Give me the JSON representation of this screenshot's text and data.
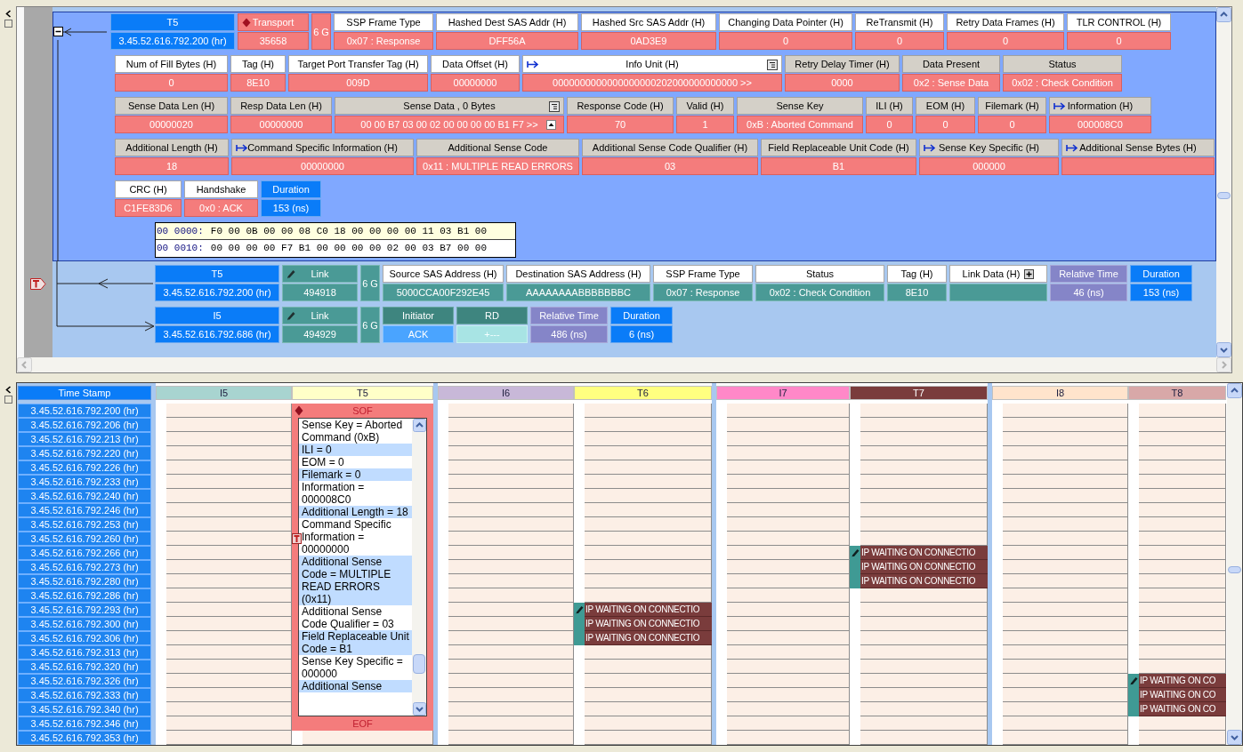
{
  "top_panel": {
    "expanded": true,
    "frame_rows": [
      [
        {
          "kind": "timestamp",
          "header": "T5",
          "value": "3.45.52.616.792.200 (hr)"
        },
        {
          "kind": "transport",
          "header": "Transport",
          "value": "35658"
        },
        {
          "kind": "speed",
          "text": "6 G"
        },
        {
          "kind": "plain",
          "header": "SSP Frame Type",
          "value": "0x07 : Response"
        },
        {
          "kind": "plain",
          "header": "Hashed Dest SAS Addr (H)",
          "value": "DFF56A"
        },
        {
          "kind": "plain",
          "header": "Hashed Src SAS Addr (H)",
          "value": "0AD3E9"
        },
        {
          "kind": "plain",
          "header": "Changing Data Pointer (H)",
          "value": "0"
        },
        {
          "kind": "plain",
          "header": "ReTransmit (H)",
          "value": "0"
        },
        {
          "kind": "plain",
          "header": "Retry Data Frames (H)",
          "value": "0"
        },
        {
          "kind": "plain",
          "header": "TLR CONTROL (H)",
          "value": "0"
        }
      ],
      [
        {
          "kind": "plain",
          "header": "Num of Fill Bytes (H)",
          "value": "0"
        },
        {
          "kind": "plain",
          "header": "Tag (H)",
          "value": "8E10"
        },
        {
          "kind": "plain",
          "header": "Target Port Transfer Tag (H)",
          "value": "009D"
        },
        {
          "kind": "plain",
          "header": "Data Offset (H)",
          "value": "00000000"
        },
        {
          "kind": "infounit",
          "header": "Info Unit (H)",
          "value": "0000000000000000000202000000000000 >>"
        },
        {
          "kind": "shaded",
          "header": "Retry Delay Timer (H)",
          "value": "0000"
        },
        {
          "kind": "shaded",
          "header": "Data Present",
          "value": "0x2 : Sense Data"
        },
        {
          "kind": "shaded",
          "header": "Status",
          "value": "0x02 : Check Condition"
        }
      ],
      [
        {
          "kind": "shaded",
          "header": "Sense Data Len (H)",
          "value": "00000020"
        },
        {
          "kind": "shaded",
          "header": "Resp Data Len (H)",
          "value": "00000000"
        },
        {
          "kind": "sensedata",
          "header": "Sense Data , 0 Bytes",
          "value": "00 00 B7 03 00 02 00 00 00 00 B1 F7  >>"
        },
        {
          "kind": "shaded",
          "header": "Response Code (H)",
          "value": "70"
        },
        {
          "kind": "shaded",
          "header": "Valid (H)",
          "value": "1"
        },
        {
          "kind": "shaded",
          "header": "Sense Key",
          "value": "0xB : Aborted Command"
        },
        {
          "kind": "shaded",
          "header": "ILI (H)",
          "value": "0"
        },
        {
          "kind": "shaded",
          "header": "EOM (H)",
          "value": "0"
        },
        {
          "kind": "shaded",
          "header": "Filemark (H)",
          "value": "0"
        },
        {
          "kind": "expandable",
          "header": "Information (H)",
          "value": "000008C0"
        }
      ],
      [
        {
          "kind": "shaded",
          "header": "Additional Length (H)",
          "value": "18"
        },
        {
          "kind": "expandable",
          "header": "Command Specific Information (H)",
          "value": "00000000"
        },
        {
          "kind": "shaded",
          "header": "Additional Sense Code",
          "value": "0x11 : MULTIPLE READ ERRORS"
        },
        {
          "kind": "shaded",
          "header": "Additional Sense Code Qualifier (H)",
          "value": "03"
        },
        {
          "kind": "shaded",
          "header": "Field Replaceable Unit Code (H)",
          "value": "B1"
        },
        {
          "kind": "expandable",
          "header": "Sense Key Specific (H)",
          "value": "000000"
        },
        {
          "kind": "expandable",
          "header": "Additional Sense Bytes (H)"
        }
      ],
      [
        {
          "kind": "plain",
          "header": "CRC (H)",
          "value": "C1FE83D6"
        },
        {
          "kind": "plain",
          "header": "Handshake",
          "value": "0x0 : ACK"
        },
        {
          "kind": "timestamp",
          "header": "Duration",
          "value": "153 (ns)"
        }
      ]
    ],
    "hex_dump": [
      {
        "offset": "00 0000:",
        "bytes": "F0 00 0B 00 00 08 C0 18 00 00 00 00 11 03 B1 00"
      },
      {
        "offset": "00 0010:",
        "bytes": "00 00 00 00 F7 B1 00 00 00 00 02 00 03 B7 00 00"
      }
    ],
    "link_rows": [
      {
        "kind": "target",
        "fields": [
          {
            "kind": "timestamp",
            "header": "T5",
            "value": "3.45.52.616.792.200 (hr)"
          },
          {
            "kind": "link",
            "header": "Link",
            "value": "494918"
          },
          {
            "kind": "speed",
            "text": "6 G"
          },
          {
            "kind": "plain",
            "header": "Source SAS Address (H)",
            "value": "5000CCA00F292E45"
          },
          {
            "kind": "plain",
            "header": "Destination SAS Address (H)",
            "value": "AAAAAAAABBBBBBBC"
          },
          {
            "kind": "plain",
            "header": "SSP Frame Type",
            "value": "0x07 : Response"
          },
          {
            "kind": "plain",
            "header": "Status",
            "value": "0x02 : Check Condition"
          },
          {
            "kind": "plain",
            "header": "Tag (H)",
            "value": "8E10"
          },
          {
            "kind": "linkdata",
            "header": "Link Data (H)"
          },
          {
            "kind": "timing",
            "header": "Relative Time",
            "value": "46 (ns)"
          },
          {
            "kind": "timestamp",
            "header": "Duration",
            "value": "153 (ns)"
          }
        ]
      },
      {
        "kind": "initiator",
        "fields": [
          {
            "kind": "timestamp",
            "header": "I5",
            "value": "3.45.52.616.792.686 (hr)"
          },
          {
            "kind": "link",
            "header": "Link",
            "value": "494929"
          },
          {
            "kind": "speed",
            "text": "6 G"
          },
          {
            "kind": "primitive",
            "header": "Initiator",
            "value": "ACK"
          },
          {
            "kind": "disparity",
            "header": "RD",
            "value": "+---"
          },
          {
            "kind": "timing",
            "header": "Relative Time",
            "value": "486 (ns)"
          },
          {
            "kind": "timestamp",
            "header": "Duration",
            "value": "6 (ns)"
          }
        ]
      }
    ]
  },
  "timeline": {
    "timestamp_header": "Time Stamp",
    "timestamps": [
      "3.45.52.616.792.200 (hr)",
      "3.45.52.616.792.206 (hr)",
      "3.45.52.616.792.213 (hr)",
      "3.45.52.616.792.220 (hr)",
      "3.45.52.616.792.226 (hr)",
      "3.45.52.616.792.233 (hr)",
      "3.45.52.616.792.240 (hr)",
      "3.45.52.616.792.246 (hr)",
      "3.45.52.616.792.253 (hr)",
      "3.45.52.616.792.260 (hr)",
      "3.45.52.616.792.266 (hr)",
      "3.45.52.616.792.273 (hr)",
      "3.45.52.616.792.280 (hr)",
      "3.45.52.616.792.286 (hr)",
      "3.45.52.616.792.293 (hr)",
      "3.45.52.616.792.300 (hr)",
      "3.45.52.616.792.306 (hr)",
      "3.45.52.616.792.313 (hr)",
      "3.45.52.616.792.320 (hr)",
      "3.45.52.616.792.326 (hr)",
      "3.45.52.616.792.333 (hr)",
      "3.45.52.616.792.340 (hr)",
      "3.45.52.616.792.346 (hr)",
      "3.45.52.616.792.353 (hr)"
    ],
    "channels": [
      {
        "label": "I5",
        "color": "#a8d4d0",
        "cells": [
          {
            "kind": "blank"
          },
          {
            "kind": "blank"
          },
          {
            "kind": "blank"
          },
          {
            "kind": "blank"
          },
          {
            "kind": "blank"
          },
          {
            "kind": "blank"
          },
          {
            "kind": "blank"
          },
          {
            "kind": "blank"
          },
          {
            "kind": "blank"
          },
          {
            "kind": "blank"
          },
          {
            "kind": "blank"
          },
          {
            "kind": "blank"
          },
          {
            "kind": "blank"
          },
          {
            "kind": "blank"
          },
          {
            "kind": "blank"
          },
          {
            "kind": "blank"
          },
          {
            "kind": "blank"
          },
          {
            "kind": "blank"
          },
          {
            "kind": "blank"
          },
          {
            "kind": "blank"
          },
          {
            "kind": "blank"
          },
          {
            "kind": "blank"
          },
          {
            "kind": "blank"
          },
          {
            "kind": "blank"
          }
        ]
      },
      {
        "label": "T5",
        "color": "#ffffc8",
        "cells": [
          {
            "kind": "popup",
            "sof": "SOF",
            "eof": "EOF",
            "lines": [
              {
                "text": "Sense Key = Aborted Command (0xB)",
                "highlighted": false
              },
              {
                "text": "ILI = 0",
                "highlighted": true
              },
              {
                "text": "EOM = 0",
                "highlighted": false
              },
              {
                "text": "Filemark = 0",
                "highlighted": true
              },
              {
                "text": "Information = 000008C0",
                "highlighted": false
              },
              {
                "text": "Additional Length = 18",
                "highlighted": true
              },
              {
                "text": "Command Specific Information = 00000000",
                "highlighted": false
              },
              {
                "text": "Additional Sense Code = MULTIPLE READ ERRORS (0x11)",
                "highlighted": true
              },
              {
                "text": "Additional Sense Code Qualifier = 03",
                "highlighted": false
              },
              {
                "text": "Field Replaceable Unit Code = B1",
                "highlighted": true
              },
              {
                "text": "Sense Key Specific = 000000",
                "highlighted": false
              },
              {
                "text": "Additional Sense",
                "highlighted": true
              }
            ]
          },
          {
            "kind": "blank"
          }
        ]
      },
      {
        "label": "I6",
        "color": "#c8b8d8",
        "cells": [
          {
            "kind": "blank"
          },
          {
            "kind": "blank"
          },
          {
            "kind": "blank"
          },
          {
            "kind": "blank"
          },
          {
            "kind": "blank"
          },
          {
            "kind": "blank"
          },
          {
            "kind": "blank"
          },
          {
            "kind": "blank"
          },
          {
            "kind": "blank"
          },
          {
            "kind": "blank"
          },
          {
            "kind": "blank"
          },
          {
            "kind": "blank"
          },
          {
            "kind": "blank"
          },
          {
            "kind": "blank"
          },
          {
            "kind": "blank"
          },
          {
            "kind": "blank"
          },
          {
            "kind": "blank"
          },
          {
            "kind": "blank"
          },
          {
            "kind": "blank"
          },
          {
            "kind": "blank"
          },
          {
            "kind": "blank"
          },
          {
            "kind": "blank"
          },
          {
            "kind": "blank"
          },
          {
            "kind": "blank"
          }
        ]
      },
      {
        "label": "T6",
        "color": "#ffff80",
        "cells": [
          {
            "kind": "blank"
          },
          {
            "kind": "blank"
          },
          {
            "kind": "blank"
          },
          {
            "kind": "blank"
          },
          {
            "kind": "blank"
          },
          {
            "kind": "blank"
          },
          {
            "kind": "blank"
          },
          {
            "kind": "blank"
          },
          {
            "kind": "blank"
          },
          {
            "kind": "blank"
          },
          {
            "kind": "blank"
          },
          {
            "kind": "blank"
          },
          {
            "kind": "blank"
          },
          {
            "kind": "blank"
          },
          {
            "kind": "event",
            "first": true,
            "text": "IP WAITING ON CONNECTIO"
          },
          {
            "kind": "event",
            "first": false,
            "text": "IP WAITING ON CONNECTIO"
          },
          {
            "kind": "event",
            "first": false,
            "text": "IP WAITING ON CONNECTIO"
          },
          {
            "kind": "blank"
          },
          {
            "kind": "blank"
          },
          {
            "kind": "blank"
          },
          {
            "kind": "blank"
          },
          {
            "kind": "blank"
          },
          {
            "kind": "blank"
          },
          {
            "kind": "blank"
          }
        ]
      },
      {
        "label": "I7",
        "color": "#ff88c8",
        "cells": [
          {
            "kind": "blank"
          },
          {
            "kind": "blank"
          },
          {
            "kind": "blank"
          },
          {
            "kind": "blank"
          },
          {
            "kind": "blank"
          },
          {
            "kind": "blank"
          },
          {
            "kind": "blank"
          },
          {
            "kind": "blank"
          },
          {
            "kind": "blank"
          },
          {
            "kind": "blank"
          },
          {
            "kind": "blank"
          },
          {
            "kind": "blank"
          },
          {
            "kind": "blank"
          },
          {
            "kind": "blank"
          },
          {
            "kind": "blank"
          },
          {
            "kind": "blank"
          },
          {
            "kind": "blank"
          },
          {
            "kind": "blank"
          },
          {
            "kind": "blank"
          },
          {
            "kind": "blank"
          },
          {
            "kind": "blank"
          },
          {
            "kind": "blank"
          },
          {
            "kind": "blank"
          },
          {
            "kind": "blank"
          }
        ]
      },
      {
        "label": "T7",
        "color": "#7a3c3c",
        "cells": [
          {
            "kind": "blank"
          },
          {
            "kind": "blank"
          },
          {
            "kind": "blank"
          },
          {
            "kind": "blank"
          },
          {
            "kind": "blank"
          },
          {
            "kind": "blank"
          },
          {
            "kind": "blank"
          },
          {
            "kind": "blank"
          },
          {
            "kind": "blank"
          },
          {
            "kind": "blank"
          },
          {
            "kind": "event",
            "first": true,
            "text": "IP WAITING ON CONNECTIO"
          },
          {
            "kind": "event",
            "first": false,
            "text": "IP WAITING ON CONNECTIO"
          },
          {
            "kind": "event",
            "first": false,
            "text": "IP WAITING ON CONNECTIO"
          },
          {
            "kind": "blank"
          },
          {
            "kind": "blank"
          },
          {
            "kind": "blank"
          },
          {
            "kind": "blank"
          },
          {
            "kind": "blank"
          },
          {
            "kind": "blank"
          },
          {
            "kind": "blank"
          },
          {
            "kind": "blank"
          },
          {
            "kind": "blank"
          },
          {
            "kind": "blank"
          },
          {
            "kind": "blank"
          }
        ]
      },
      {
        "label": "I8",
        "color": "#ffe4cc",
        "cells": [
          {
            "kind": "blank"
          },
          {
            "kind": "blank"
          },
          {
            "kind": "blank"
          },
          {
            "kind": "blank"
          },
          {
            "kind": "blank"
          },
          {
            "kind": "blank"
          },
          {
            "kind": "blank"
          },
          {
            "kind": "blank"
          },
          {
            "kind": "blank"
          },
          {
            "kind": "blank"
          },
          {
            "kind": "blank"
          },
          {
            "kind": "blank"
          },
          {
            "kind": "blank"
          },
          {
            "kind": "blank"
          },
          {
            "kind": "blank"
          },
          {
            "kind": "blank"
          },
          {
            "kind": "blank"
          },
          {
            "kind": "blank"
          },
          {
            "kind": "blank"
          },
          {
            "kind": "blank"
          },
          {
            "kind": "blank"
          },
          {
            "kind": "blank"
          },
          {
            "kind": "blank"
          },
          {
            "kind": "blank"
          }
        ]
      },
      {
        "label": "T8",
        "color": "#d8a8a8",
        "cells": [
          {
            "kind": "blank"
          },
          {
            "kind": "blank"
          },
          {
            "kind": "blank"
          },
          {
            "kind": "blank"
          },
          {
            "kind": "blank"
          },
          {
            "kind": "blank"
          },
          {
            "kind": "blank"
          },
          {
            "kind": "blank"
          },
          {
            "kind": "blank"
          },
          {
            "kind": "blank"
          },
          {
            "kind": "blank"
          },
          {
            "kind": "blank"
          },
          {
            "kind": "blank"
          },
          {
            "kind": "blank"
          },
          {
            "kind": "blank"
          },
          {
            "kind": "blank"
          },
          {
            "kind": "blank"
          },
          {
            "kind": "blank"
          },
          {
            "kind": "blank"
          },
          {
            "kind": "event",
            "first": true,
            "text": "IP WAITING ON CO"
          },
          {
            "kind": "event",
            "first": false,
            "text": "IP WAITING ON CO"
          },
          {
            "kind": "event",
            "first": false,
            "text": "IP WAITING ON CO"
          },
          {
            "kind": "blank"
          },
          {
            "kind": "blank"
          }
        ]
      }
    ]
  }
}
